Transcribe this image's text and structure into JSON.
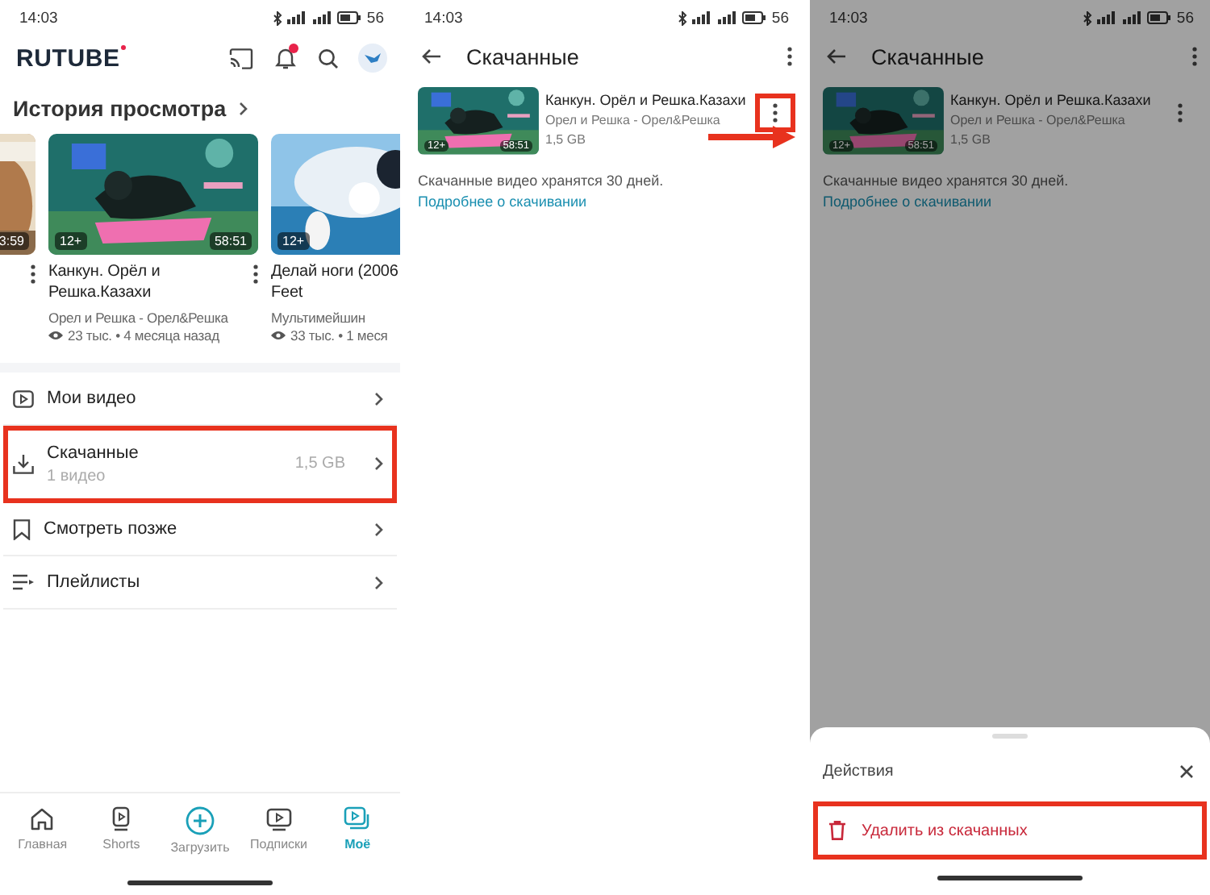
{
  "screens": [
    {
      "kind": "library",
      "status": {
        "time": "14:03",
        "battery": "56"
      },
      "logo": "RUTUBE",
      "section_title": "История просмотра",
      "history": [
        {
          "duration": "3:59"
        },
        {
          "age": "12+",
          "duration": "58:51",
          "title": "Канкун. Орёл и Решка.Казахи",
          "channel": "Орел и Решка - Орел&Решка",
          "stats": "23 тыс. • 4 месяца назад"
        },
        {
          "age": "12+",
          "title": "Делай ноги (2006\nFeet",
          "channel": "Мультимейшин",
          "stats": "33 тыс. • 1 меся"
        }
      ],
      "menu": [
        {
          "label": "Мои видео",
          "highlighted": false
        },
        {
          "label": "Скачанные",
          "subtitle": "1 видео",
          "size": "1,5 GB",
          "highlighted": true
        },
        {
          "label": "Смотреть позже",
          "highlighted": false
        },
        {
          "label": "Плейлисты",
          "highlighted": false
        }
      ],
      "nav": [
        {
          "label": "Главная",
          "selected": false
        },
        {
          "label": "Shorts",
          "selected": false
        },
        {
          "label": "Загрузить",
          "selected": false
        },
        {
          "label": "Подписки",
          "selected": false
        },
        {
          "label": "Моё",
          "selected": true
        }
      ]
    },
    {
      "kind": "downloads",
      "status": {
        "time": "14:03",
        "battery": "56"
      },
      "title": "Скачанные",
      "dimmed": false,
      "item": {
        "age": "12+",
        "duration": "58:51",
        "title": "Канкун. Орёл и Решка.Казахи",
        "channel": "Орел и Решка - Орел&Решка",
        "size": "1,5 GB",
        "menu_highlighted": true,
        "pointer_arrow": true
      },
      "note": "Скачанные видео хранятся 30 дней.",
      "link": "Подробнее о скачивании"
    },
    {
      "kind": "downloads",
      "status": {
        "time": "14:03",
        "battery": "56"
      },
      "title": "Скачанные",
      "dimmed": true,
      "item": {
        "age": "12+",
        "duration": "58:51",
        "title": "Канкун. Орёл и Решка.Казахи",
        "channel": "Орел и Решка - Орел&Решка",
        "size": "1,5 GB",
        "menu_highlighted": false,
        "pointer_arrow": false
      },
      "note": "Скачанные видео хранятся 30 дней.",
      "link": "Подробнее о скачивании",
      "sheet": {
        "title": "Действия",
        "actions": [
          {
            "label": "Удалить из скачанных",
            "highlighted": true
          }
        ]
      }
    }
  ]
}
